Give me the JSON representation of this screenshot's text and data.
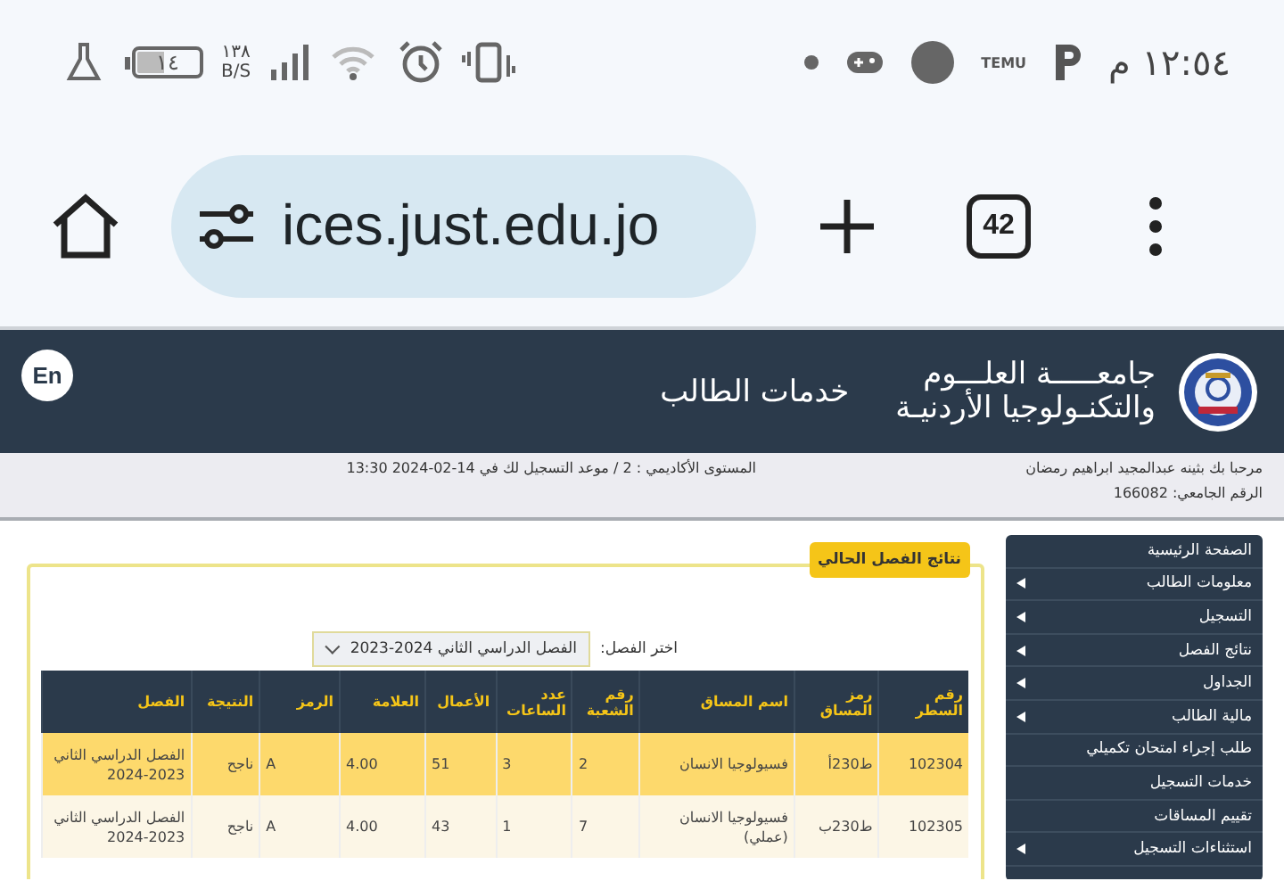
{
  "status_bar": {
    "battery": "١٤",
    "network_speed": "١٣٨",
    "network_unit": "B/S",
    "app_label": "TEMU",
    "time": "١٢:٥٤ م"
  },
  "browser": {
    "url": "ices.just.edu.jo",
    "tab_count": "42"
  },
  "header": {
    "language_button": "En",
    "title": "خدمات الطالب",
    "university_name": [
      "جامعـــــة العلـــوم",
      "والتكنـولوجيا الأردنيـة"
    ]
  },
  "info_bar": {
    "welcome": "مرحبا بك بثينه عبدالمجيد ابراهيم رمضان",
    "university_id": "الرقم الجامعي: 166082",
    "level": "المستوى الأكاديمي : 2 / موعد التسجيل لك في 14-02-2024 13:30"
  },
  "sidebar": {
    "items": [
      {
        "label": "الصفحة الرئيسية",
        "has_submenu": false
      },
      {
        "label": "معلومات الطالب",
        "has_submenu": true
      },
      {
        "label": "التسجيل",
        "has_submenu": true
      },
      {
        "label": "نتائج الفصل",
        "has_submenu": true
      },
      {
        "label": "الجداول",
        "has_submenu": true
      },
      {
        "label": "مالية الطالب",
        "has_submenu": true
      },
      {
        "label": "طلب إجراء امتحان تكميلي",
        "has_submenu": false
      },
      {
        "label": "خدمات التسجيل",
        "has_submenu": false
      },
      {
        "label": "تقييم المساقات",
        "has_submenu": false
      },
      {
        "label": "استثناءات التسجيل",
        "has_submenu": true
      }
    ]
  },
  "results": {
    "title": "نتائج الفصل الحالي",
    "semester_label": "اختر الفصل:",
    "semester_value": "الفصل الدراسي الثاني 2024-2023",
    "columns": [
      "رقم السطر",
      "رمز المساق",
      "اسم المساق",
      "رقم الشعبة",
      "عدد الساعات",
      "الأعمال",
      "العلامة",
      "الرمز",
      "النتيجة",
      "الفصل"
    ],
    "rows": [
      {
        "highlighted": true,
        "cells": [
          "102304",
          "ط230أ",
          "فسيولوجيا الانسان",
          "2",
          "3",
          "51",
          "4.00",
          "A",
          "ناجح",
          "الفصل الدراسي الثاني 2023-2024"
        ]
      },
      {
        "highlighted": false,
        "cells": [
          "102305",
          "ط230ب",
          "فسيولوجيا الانسان (عملي)",
          "7",
          "1",
          "43",
          "4.00",
          "A",
          "ناجح",
          "الفصل الدراسي الثاني 2023-2024"
        ]
      }
    ]
  }
}
